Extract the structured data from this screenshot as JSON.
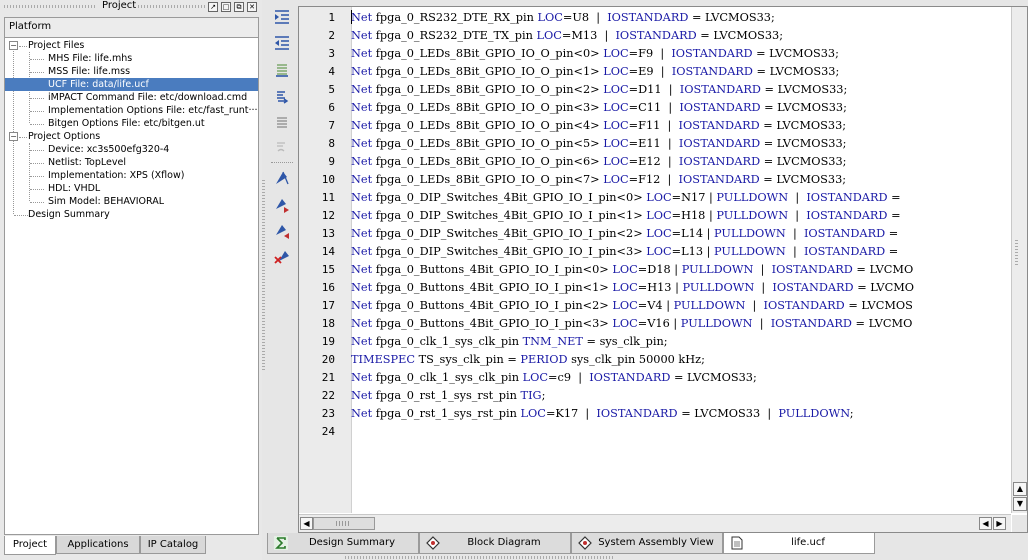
{
  "project_panel": {
    "title": "Project",
    "header": "Platform",
    "tree": [
      {
        "label": "Project Files",
        "level": 0,
        "expanded": true
      },
      {
        "label": "MHS File: life.mhs",
        "level": 1
      },
      {
        "label": "MSS File: life.mss",
        "level": 1
      },
      {
        "label": "UCF File: data/life.ucf",
        "level": 1,
        "selected": true
      },
      {
        "label": "iMPACT Command File: etc/download.cmd",
        "level": 1
      },
      {
        "label": "Implementation Options File: etc/fast_runt···",
        "level": 1
      },
      {
        "label": "Bitgen Options File: etc/bitgen.ut",
        "level": 1
      },
      {
        "label": "Project Options",
        "level": 0,
        "expanded": true
      },
      {
        "label": "Device: xc3s500efg320-4",
        "level": 1
      },
      {
        "label": "Netlist: TopLevel",
        "level": 1
      },
      {
        "label": "Implementation: XPS (Xflow)",
        "level": 1
      },
      {
        "label": "HDL: VHDL",
        "level": 1
      },
      {
        "label": "Sim Model: BEHAVIORAL",
        "level": 1
      },
      {
        "label": "Design Summary",
        "level": 0
      }
    ],
    "tabs": [
      {
        "label": "Project",
        "active": true
      },
      {
        "label": "Applications"
      },
      {
        "label": "IP Catalog"
      }
    ]
  },
  "toolbar_icons": [
    "indent-icon",
    "unindent-icon",
    "comment-icon",
    "uncomment-icon",
    "toggle-comment-icon",
    "bookmark-icon",
    "toggle-bookmark-icon",
    "next-bookmark-icon",
    "previous-bookmark-icon",
    "clear-bookmarks-icon"
  ],
  "editor": {
    "lines": [
      [
        [
          "kw",
          "Net"
        ],
        [
          "t",
          " fpga_0_RS232_DTE_RX_pin "
        ],
        [
          "kw",
          "LOC"
        ],
        [
          "t",
          "=U8  |  "
        ],
        [
          "kw",
          "IOSTANDARD"
        ],
        [
          "t",
          " = LVCMOS33;"
        ]
      ],
      [
        [
          "kw",
          "Net"
        ],
        [
          "t",
          " fpga_0_RS232_DTE_TX_pin "
        ],
        [
          "kw",
          "LOC"
        ],
        [
          "t",
          "=M13  |  "
        ],
        [
          "kw",
          "IOSTANDARD"
        ],
        [
          "t",
          " = LVCMOS33;"
        ]
      ],
      [
        [
          "kw",
          "Net"
        ],
        [
          "t",
          " fpga_0_LEDs_8Bit_GPIO_IO_O_pin<0> "
        ],
        [
          "kw",
          "LOC"
        ],
        [
          "t",
          "=F9  |  "
        ],
        [
          "kw",
          "IOSTANDARD"
        ],
        [
          "t",
          " = LVCMOS33;"
        ]
      ],
      [
        [
          "kw",
          "Net"
        ],
        [
          "t",
          " fpga_0_LEDs_8Bit_GPIO_IO_O_pin<1> "
        ],
        [
          "kw",
          "LOC"
        ],
        [
          "t",
          "=E9  |  "
        ],
        [
          "kw",
          "IOSTANDARD"
        ],
        [
          "t",
          " = LVCMOS33;"
        ]
      ],
      [
        [
          "kw",
          "Net"
        ],
        [
          "t",
          " fpga_0_LEDs_8Bit_GPIO_IO_O_pin<2> "
        ],
        [
          "kw",
          "LOC"
        ],
        [
          "t",
          "=D11  |  "
        ],
        [
          "kw",
          "IOSTANDARD"
        ],
        [
          "t",
          " = LVCMOS33;"
        ]
      ],
      [
        [
          "kw",
          "Net"
        ],
        [
          "t",
          " fpga_0_LEDs_8Bit_GPIO_IO_O_pin<3> "
        ],
        [
          "kw",
          "LOC"
        ],
        [
          "t",
          "=C11  |  "
        ],
        [
          "kw",
          "IOSTANDARD"
        ],
        [
          "t",
          " = LVCMOS33;"
        ]
      ],
      [
        [
          "kw",
          "Net"
        ],
        [
          "t",
          " fpga_0_LEDs_8Bit_GPIO_IO_O_pin<4> "
        ],
        [
          "kw",
          "LOC"
        ],
        [
          "t",
          "=F11  |  "
        ],
        [
          "kw",
          "IOSTANDARD"
        ],
        [
          "t",
          " = LVCMOS33;"
        ]
      ],
      [
        [
          "kw",
          "Net"
        ],
        [
          "t",
          " fpga_0_LEDs_8Bit_GPIO_IO_O_pin<5> "
        ],
        [
          "kw",
          "LOC"
        ],
        [
          "t",
          "=E11  |  "
        ],
        [
          "kw",
          "IOSTANDARD"
        ],
        [
          "t",
          " = LVCMOS33;"
        ]
      ],
      [
        [
          "kw",
          "Net"
        ],
        [
          "t",
          " fpga_0_LEDs_8Bit_GPIO_IO_O_pin<6> "
        ],
        [
          "kw",
          "LOC"
        ],
        [
          "t",
          "=E12  |  "
        ],
        [
          "kw",
          "IOSTANDARD"
        ],
        [
          "t",
          " = LVCMOS33;"
        ]
      ],
      [
        [
          "kw",
          "Net"
        ],
        [
          "t",
          " fpga_0_LEDs_8Bit_GPIO_IO_O_pin<7> "
        ],
        [
          "kw",
          "LOC"
        ],
        [
          "t",
          "=F12  |  "
        ],
        [
          "kw",
          "IOSTANDARD"
        ],
        [
          "t",
          " = LVCMOS33;"
        ]
      ],
      [
        [
          "kw",
          "Net"
        ],
        [
          "t",
          " fpga_0_DIP_Switches_4Bit_GPIO_IO_I_pin<0> "
        ],
        [
          "kw",
          "LOC"
        ],
        [
          "t",
          "=N17 | "
        ],
        [
          "kw",
          "PULLDOWN"
        ],
        [
          "t",
          "  |  "
        ],
        [
          "kw",
          "IOSTANDARD"
        ],
        [
          "t",
          " ="
        ]
      ],
      [
        [
          "kw",
          "Net"
        ],
        [
          "t",
          " fpga_0_DIP_Switches_4Bit_GPIO_IO_I_pin<1> "
        ],
        [
          "kw",
          "LOC"
        ],
        [
          "t",
          "=H18 | "
        ],
        [
          "kw",
          "PULLDOWN"
        ],
        [
          "t",
          "  |  "
        ],
        [
          "kw",
          "IOSTANDARD"
        ],
        [
          "t",
          " ="
        ]
      ],
      [
        [
          "kw",
          "Net"
        ],
        [
          "t",
          " fpga_0_DIP_Switches_4Bit_GPIO_IO_I_pin<2> "
        ],
        [
          "kw",
          "LOC"
        ],
        [
          "t",
          "=L14 | "
        ],
        [
          "kw",
          "PULLDOWN"
        ],
        [
          "t",
          "  |  "
        ],
        [
          "kw",
          "IOSTANDARD"
        ],
        [
          "t",
          " ="
        ]
      ],
      [
        [
          "kw",
          "Net"
        ],
        [
          "t",
          " fpga_0_DIP_Switches_4Bit_GPIO_IO_I_pin<3> "
        ],
        [
          "kw",
          "LOC"
        ],
        [
          "t",
          "=L13 | "
        ],
        [
          "kw",
          "PULLDOWN"
        ],
        [
          "t",
          "  |  "
        ],
        [
          "kw",
          "IOSTANDARD"
        ],
        [
          "t",
          " ="
        ]
      ],
      [
        [
          "kw",
          "Net"
        ],
        [
          "t",
          " fpga_0_Buttons_4Bit_GPIO_IO_I_pin<0> "
        ],
        [
          "kw",
          "LOC"
        ],
        [
          "t",
          "=D18 | "
        ],
        [
          "kw",
          "PULLDOWN"
        ],
        [
          "t",
          "  |  "
        ],
        [
          "kw",
          "IOSTANDARD"
        ],
        [
          "t",
          " = LVCMO"
        ]
      ],
      [
        [
          "kw",
          "Net"
        ],
        [
          "t",
          " fpga_0_Buttons_4Bit_GPIO_IO_I_pin<1> "
        ],
        [
          "kw",
          "LOC"
        ],
        [
          "t",
          "=H13 | "
        ],
        [
          "kw",
          "PULLDOWN"
        ],
        [
          "t",
          "  |  "
        ],
        [
          "kw",
          "IOSTANDARD"
        ],
        [
          "t",
          " = LVCMO"
        ]
      ],
      [
        [
          "kw",
          "Net"
        ],
        [
          "t",
          " fpga_0_Buttons_4Bit_GPIO_IO_I_pin<2> "
        ],
        [
          "kw",
          "LOC"
        ],
        [
          "t",
          "=V4 | "
        ],
        [
          "kw",
          "PULLDOWN"
        ],
        [
          "t",
          "  |  "
        ],
        [
          "kw",
          "IOSTANDARD"
        ],
        [
          "t",
          " = LVCMOS"
        ]
      ],
      [
        [
          "kw",
          "Net"
        ],
        [
          "t",
          " fpga_0_Buttons_4Bit_GPIO_IO_I_pin<3> "
        ],
        [
          "kw",
          "LOC"
        ],
        [
          "t",
          "=V16 | "
        ],
        [
          "kw",
          "PULLDOWN"
        ],
        [
          "t",
          "  |  "
        ],
        [
          "kw",
          "IOSTANDARD"
        ],
        [
          "t",
          " = LVCMO"
        ]
      ],
      [
        [
          "kw",
          "Net"
        ],
        [
          "t",
          " fpga_0_clk_1_sys_clk_pin "
        ],
        [
          "kw",
          "TNM_NET"
        ],
        [
          "t",
          " = sys_clk_pin;"
        ]
      ],
      [
        [
          "kw",
          "TIMESPEC"
        ],
        [
          "t",
          " TS_sys_clk_pin = "
        ],
        [
          "kw",
          "PERIOD"
        ],
        [
          "t",
          " sys_clk_pin 50000 kHz;"
        ]
      ],
      [
        [
          "kw",
          "Net"
        ],
        [
          "t",
          " fpga_0_clk_1_sys_clk_pin "
        ],
        [
          "kw",
          "LOC"
        ],
        [
          "t",
          "=c9  |  "
        ],
        [
          "kw",
          "IOSTANDARD"
        ],
        [
          "t",
          " = LVCMOS33;"
        ]
      ],
      [
        [
          "kw",
          "Net"
        ],
        [
          "t",
          " fpga_0_rst_1_sys_rst_pin "
        ],
        [
          "kw",
          "TIG"
        ],
        [
          "t",
          ";"
        ]
      ],
      [
        [
          "kw",
          "Net"
        ],
        [
          "t",
          " fpga_0_rst_1_sys_rst_pin "
        ],
        [
          "kw",
          "LOC"
        ],
        [
          "t",
          "=K17  |  "
        ],
        [
          "kw",
          "IOSTANDARD"
        ],
        [
          "t",
          " = LVCMOS33  |  "
        ],
        [
          "kw",
          "PULLDOWN"
        ],
        [
          "t",
          ";"
        ]
      ],
      []
    ],
    "line_numbers": [
      "1",
      "2",
      "3",
      "4",
      "5",
      "6",
      "7",
      "8",
      "9",
      "10",
      "11",
      "12",
      "13",
      "14",
      "15",
      "16",
      "17",
      "18",
      "19",
      "20",
      "21",
      "22",
      "23",
      "24"
    ]
  },
  "doc_tabs": [
    {
      "label": "Design Summary",
      "icon": "sigma-icon"
    },
    {
      "label": "Block Diagram",
      "icon": "diagram-icon"
    },
    {
      "label": "System Assembly View",
      "icon": "diagram-icon"
    },
    {
      "label": "life.ucf",
      "icon": "document-icon",
      "active": true
    }
  ],
  "colors": {
    "keyword": "#1a1aa6",
    "selection": "#4a7cbf",
    "toolbar_icon": "#2f57a8"
  }
}
